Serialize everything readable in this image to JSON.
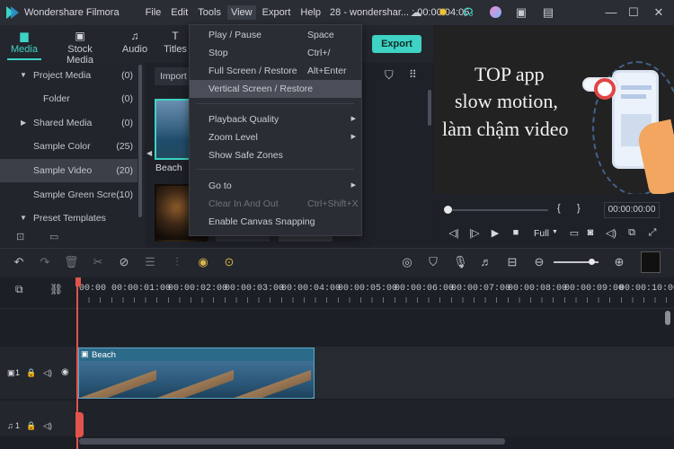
{
  "window": {
    "app_name": "Wondershare Filmora",
    "project_info": "28 - wondershar... : 00:00:04:05"
  },
  "menu": [
    "File",
    "Edit",
    "Tools",
    "View",
    "Export",
    "Help"
  ],
  "titlebar_icons": [
    "cloud-icon",
    "bulb-icon",
    "headset-icon",
    "avatar-icon",
    "save-icon",
    "layout-icon",
    "minimize-icon",
    "maximize-icon",
    "close-icon"
  ],
  "tabs": [
    {
      "label": "Media",
      "icon": "folder-icon",
      "active": true
    },
    {
      "label": "Stock Media",
      "icon": "stock-icon",
      "active": false
    },
    {
      "label": "Audio",
      "icon": "music-icon",
      "active": false
    },
    {
      "label": "Titles",
      "icon": "text-icon",
      "active": false
    }
  ],
  "export_label": "Export",
  "import_label": "Import",
  "sidebar": [
    {
      "label": "Project Media",
      "count": "(0)",
      "arrow": "down"
    },
    {
      "label": "Folder",
      "count": "(0)",
      "arrow": ""
    },
    {
      "label": "Shared Media",
      "count": "(0)",
      "arrow": "right"
    },
    {
      "label": "Sample Color",
      "count": "(25)",
      "arrow": ""
    },
    {
      "label": "Sample Video",
      "count": "(20)",
      "arrow": "",
      "selected": true
    },
    {
      "label": "Sample Green Scre...",
      "count": "(10)",
      "arrow": ""
    },
    {
      "label": "Preset Templates",
      "count": "",
      "arrow": "down"
    }
  ],
  "media_items": [
    {
      "label": "Beach"
    }
  ],
  "view_menu": [
    {
      "label": "Play / Pause",
      "shortcut": "Space"
    },
    {
      "label": "Stop",
      "shortcut": "Ctrl+/"
    },
    {
      "label": "Full Screen / Restore",
      "shortcut": "Alt+Enter"
    },
    {
      "label": "Vertical Screen / Restore",
      "shortcut": "",
      "highlighted": true
    },
    {
      "label": "Playback Quality",
      "shortcut": "",
      "submenu": true
    },
    {
      "label": "Zoom Level",
      "shortcut": "",
      "submenu": true
    },
    {
      "label": "Show Safe Zones",
      "shortcut": ""
    },
    {
      "label": "Go to",
      "shortcut": "",
      "submenu": true
    },
    {
      "label": "Clear In And Out",
      "shortcut": "Ctrl+Shift+X",
      "disabled": true
    },
    {
      "label": "Enable Canvas Snapping",
      "shortcut": ""
    }
  ],
  "preview": {
    "overlay_lines": [
      "TOP app",
      "slow motion,",
      "làm chậm video"
    ],
    "timecode": "00:00:00:00",
    "braces": "{      }",
    "quality": "Full"
  },
  "timeline": {
    "ticks": [
      "00:00",
      "00:00:01:00",
      "00:00:02:00",
      "00:00:03:00",
      "00:00:04:00",
      "00:00:05:00",
      "00:00:06:00",
      "00:00:07:00",
      "00:00:08:00",
      "00:00:09:00",
      "00:00:10:00"
    ],
    "clip_label": "Beach",
    "video_track": "1",
    "audio_track": "1"
  }
}
